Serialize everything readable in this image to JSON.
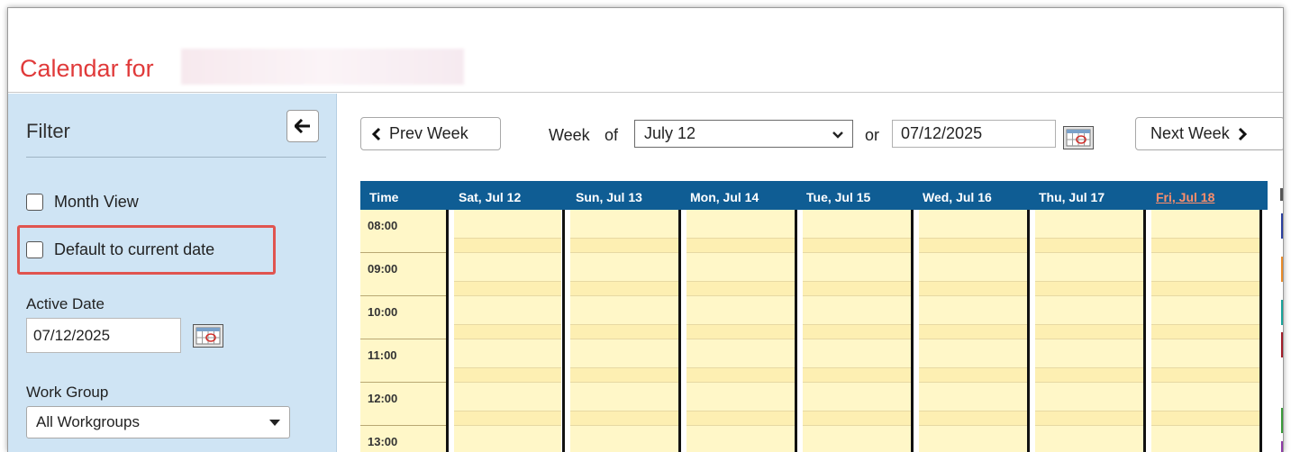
{
  "header": {
    "title": "Calendar for"
  },
  "sidebar": {
    "filter_title": "Filter",
    "month_view_label": "Month View",
    "default_current_label": "Default to current date",
    "active_date_label": "Active Date",
    "active_date_value": "07/12/2025",
    "work_group_label": "Work Group",
    "work_group_value": "All Workgroups"
  },
  "toolbar": {
    "prev_label": "Prev Week",
    "week_label": "Week",
    "of_label": "of",
    "week_select_value": "July 12",
    "or_label": "or",
    "date_value": "07/12/2025",
    "next_label": "Next Week"
  },
  "calendar": {
    "time_header": "Time",
    "days": [
      "Sat, Jul 12",
      "Sun, Jul 13",
      "Mon, Jul 14",
      "Tue, Jul 15",
      "Wed, Jul 16",
      "Thu, Jul 17",
      "Fri, Jul 18"
    ],
    "today_index": 6,
    "times": [
      "08:00",
      "09:00",
      "10:00",
      "11:00",
      "12:00",
      "13:00"
    ]
  },
  "colors": {
    "title_red": "#e03a3a",
    "sidebar_bg": "#cfe4f4",
    "grid_header": "#0f5d94",
    "today_header": "#ff8e6b",
    "slot_fill": "#fff7c8",
    "highlight": "#e0544f"
  }
}
